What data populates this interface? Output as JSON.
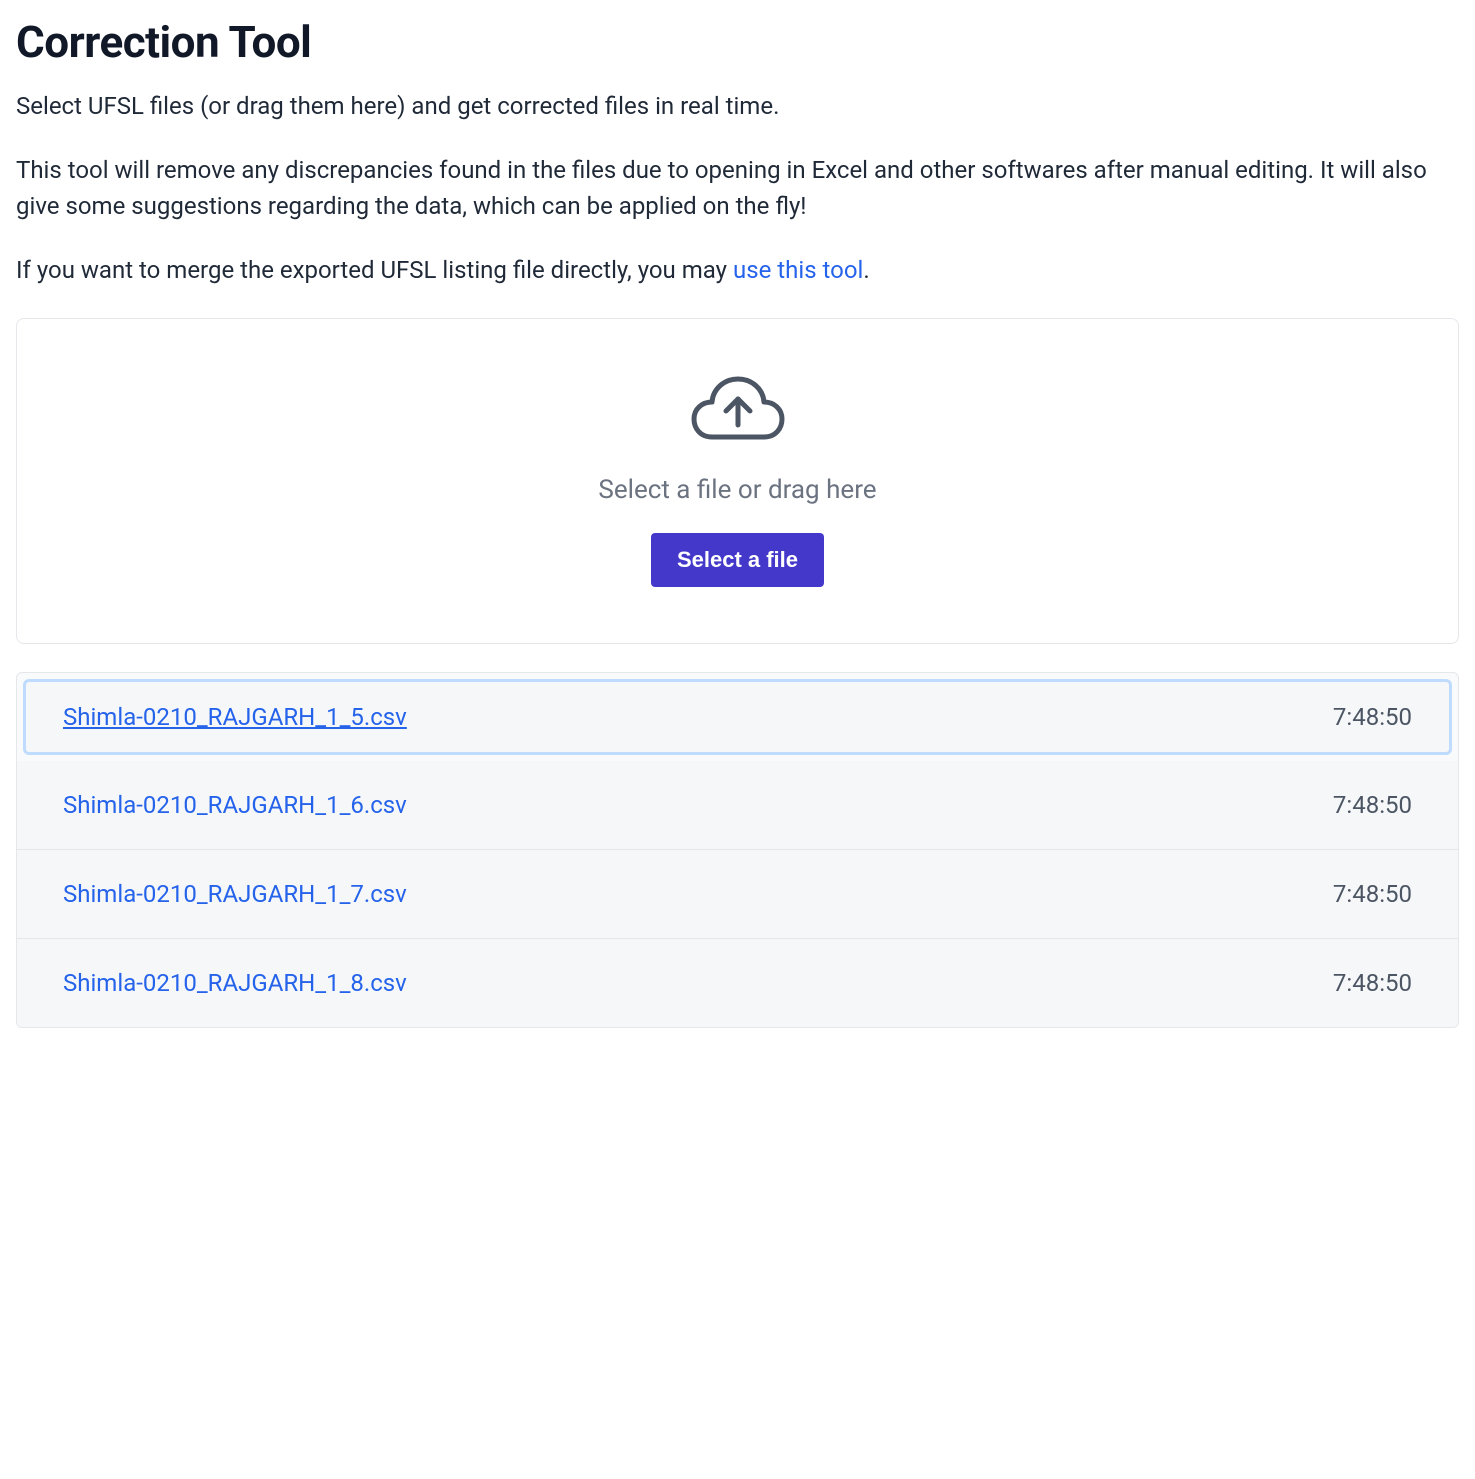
{
  "header": {
    "title": "Correction Tool"
  },
  "intro": {
    "line1": "Select UFSL files (or drag them here) and get corrected files in real time.",
    "line2": "This tool will remove any discrepancies found in the files due to opening in Excel and other softwares after manual editing. It will also give some suggestions regarding the data, which can be applied on the fly!",
    "line3_prefix": "If you want to merge the exported UFSL listing file directly, you may ",
    "line3_link": "use this tool",
    "line3_suffix": "."
  },
  "dropzone": {
    "instruction": "Select a file or drag here",
    "button_label": "Select a file"
  },
  "files": [
    {
      "name": "Shimla-0210_RAJGARH_1_5.csv",
      "time": "7:48:50",
      "selected": true
    },
    {
      "name": "Shimla-0210_RAJGARH_1_6.csv",
      "time": "7:48:50",
      "selected": false
    },
    {
      "name": "Shimla-0210_RAJGARH_1_7.csv",
      "time": "7:48:50",
      "selected": false
    },
    {
      "name": "Shimla-0210_RAJGARH_1_8.csv",
      "time": "7:48:50",
      "selected": false
    }
  ]
}
